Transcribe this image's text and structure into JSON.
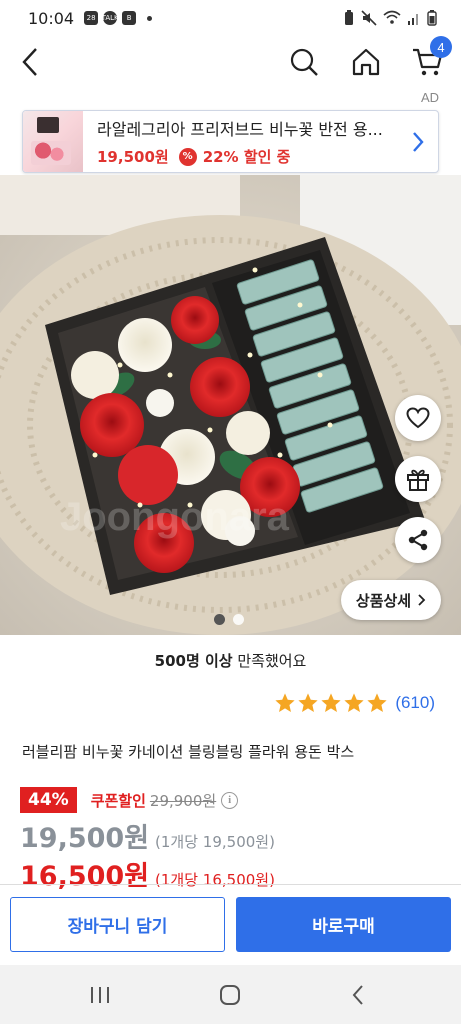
{
  "status_bar": {
    "time": "10:04",
    "notif_icons": [
      "28",
      "TALK",
      "B"
    ]
  },
  "header": {
    "back_icon": "chevron-left-icon",
    "search_icon": "search-icon",
    "home_icon": "home-icon",
    "cart_icon": "cart-icon",
    "cart_count": "4"
  },
  "ad": {
    "label": "AD",
    "title": "라알레그리아 프리저브드 비누꽃 반전 용...",
    "price": "19,500원",
    "discount_icon": "%",
    "discount": "22% 할인 중"
  },
  "gallery": {
    "watermark": "Joongonara",
    "slide_count": 2,
    "active_slide": 0,
    "detail_label": "상품상세"
  },
  "product": {
    "satisfaction_bold": "500명 이상",
    "satisfaction_rest": " 만족했어요",
    "rating_stars": 5,
    "review_count": "(610)",
    "name": "러블리팜 비누꽃 카네이션 블링블링 플라워 용돈 박스",
    "discount_badge": "44%",
    "coupon_label": "쿠폰할인",
    "original_price": "29,900원",
    "info_icon": "i",
    "sale_price": "19,500원",
    "sale_unit": "(1개당 19,500원)",
    "coupon_price": "16,500원",
    "coupon_unit": "(1개당 16,500원)"
  },
  "actions": {
    "cart_button": "장바구니 담기",
    "buy_button": "바로구매"
  },
  "colors": {
    "accent": "#2f6fe8",
    "sale_red": "#e02020",
    "star": "#f5a623"
  }
}
